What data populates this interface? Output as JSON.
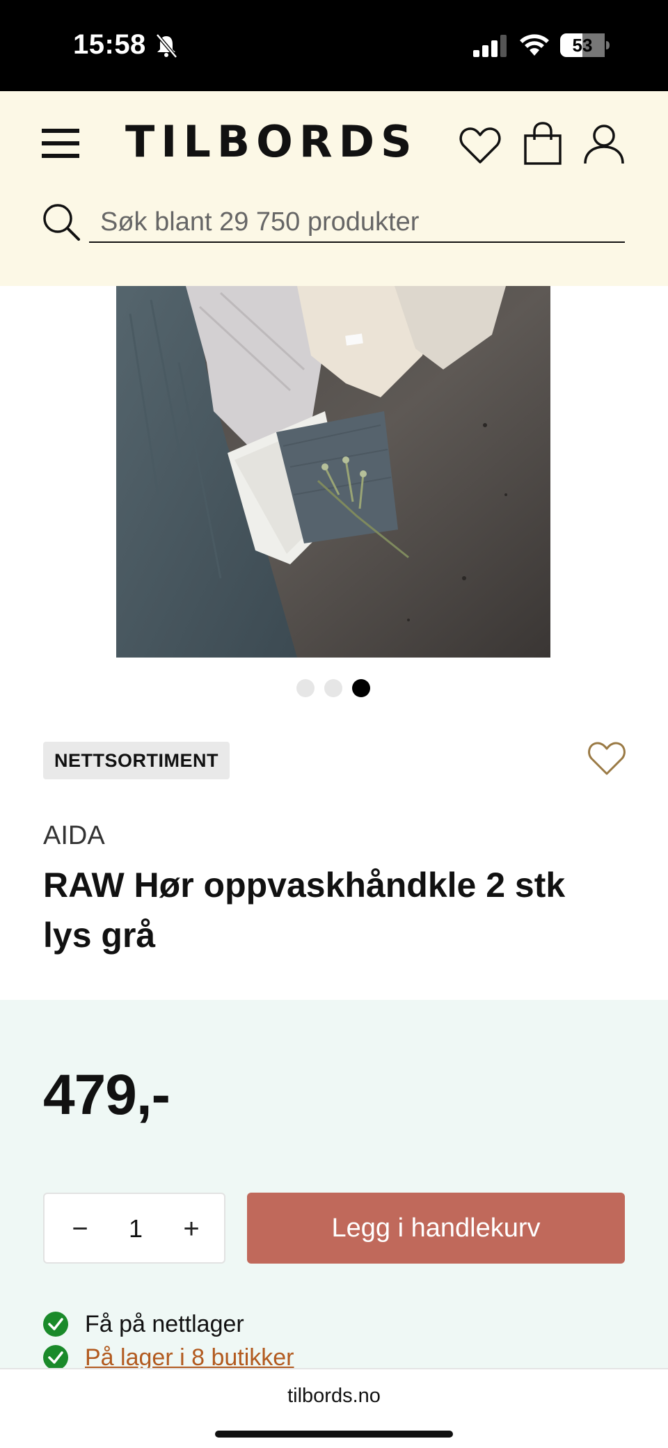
{
  "status_bar": {
    "time": "15:58",
    "battery": "53"
  },
  "header": {
    "logo": "TILBORDS",
    "search_placeholder": "Søk blant 29 750 produkter"
  },
  "carousel": {
    "slide_count": 3,
    "active_index": 2
  },
  "product": {
    "badge": "NETTSORTIMENT",
    "brand": "AIDA",
    "title": "RAW Hør oppvaskhåndkle 2 stk lys grå"
  },
  "purchase": {
    "price": "479,-",
    "quantity": "1",
    "minus": "−",
    "plus": "+",
    "add_to_cart": "Legg i handlekurv",
    "stock_online": "Få på nettlager",
    "stock_stores": "På lager i 8 butikker"
  },
  "browser": {
    "url": "tilbords.no"
  },
  "colors": {
    "header_bg": "#fcf8e6",
    "purchase_bg": "#eff8f5",
    "add_to_cart": "#c0695b",
    "stock_check": "#1a8a2a",
    "store_link": "#b25a1f",
    "wishlist_accent": "#9a7a45"
  },
  "icons": [
    "menu-icon",
    "heart-icon",
    "bag-icon",
    "user-icon",
    "search-icon",
    "check-icon"
  ]
}
